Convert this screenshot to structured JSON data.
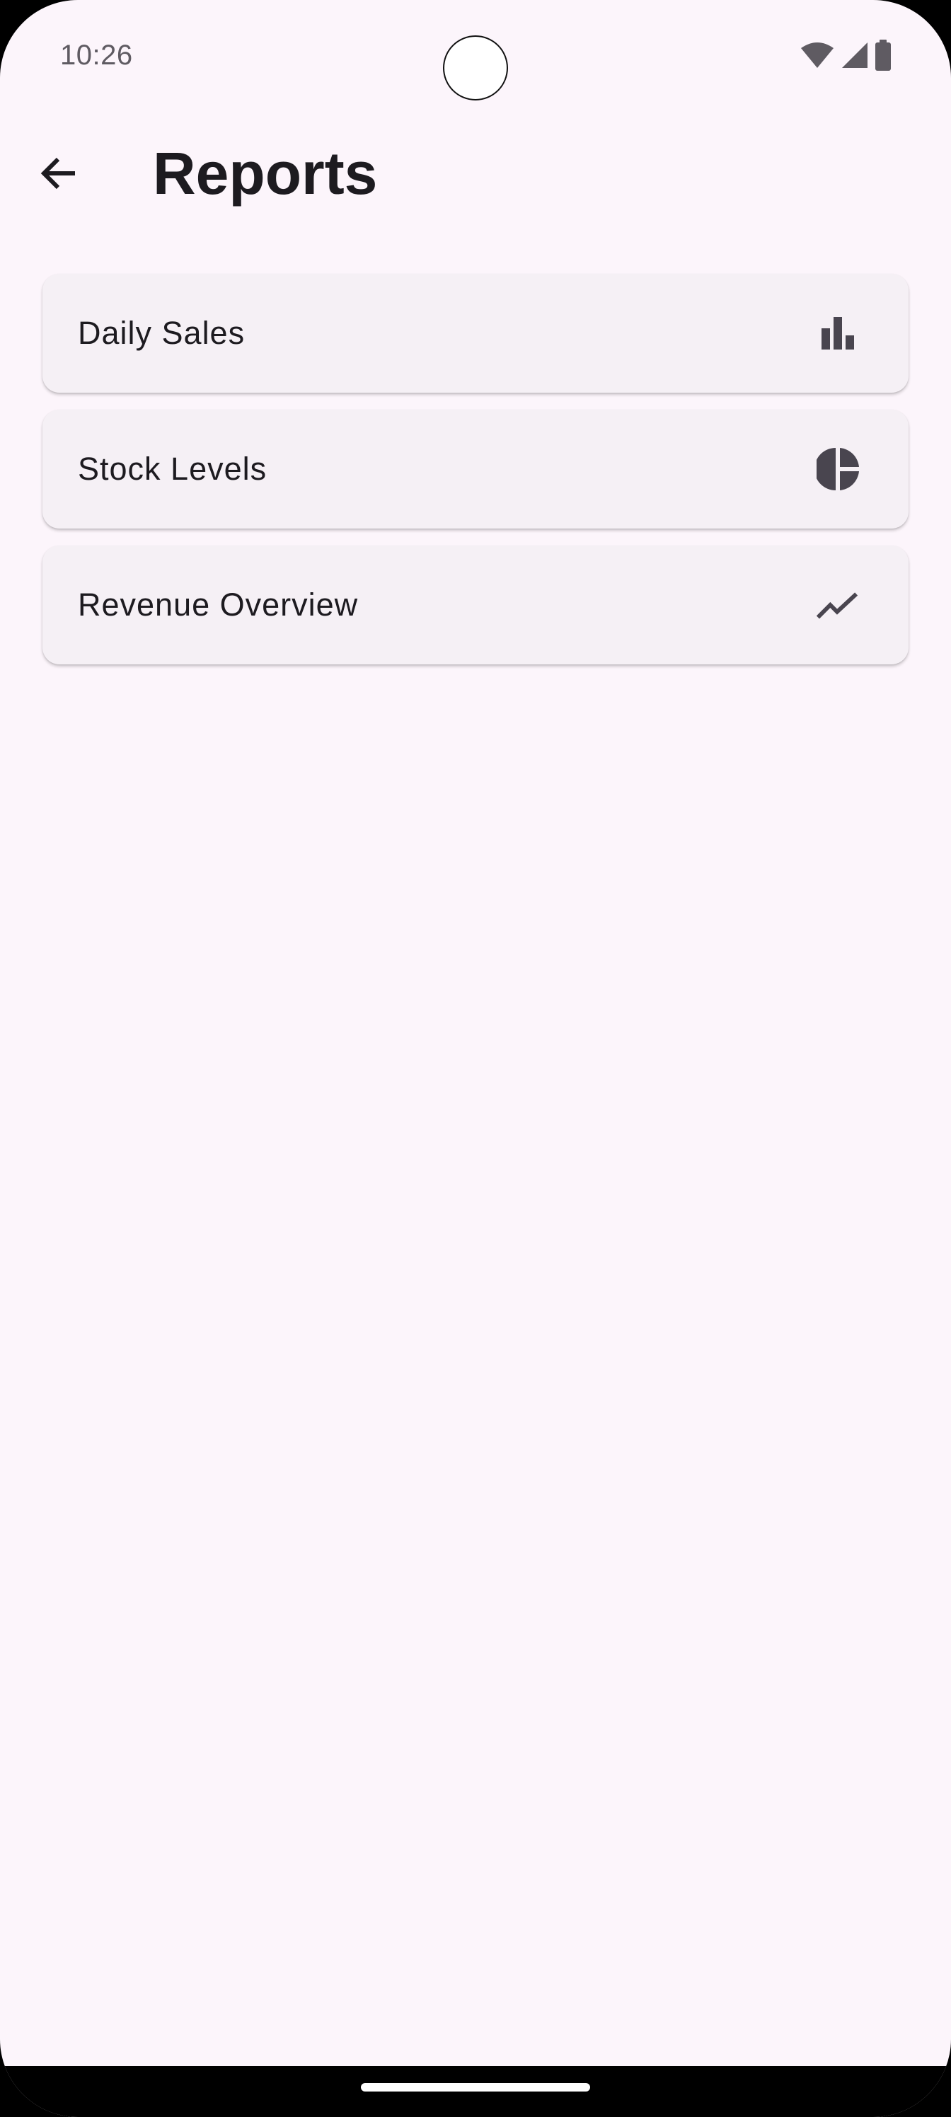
{
  "status_bar": {
    "time": "10:26",
    "icons": [
      "wifi-icon",
      "cellular-signal-icon",
      "battery-icon"
    ]
  },
  "app_bar": {
    "back_icon": "arrow-back-icon",
    "title": "Reports"
  },
  "reports": [
    {
      "label": "Daily Sales",
      "icon": "bar-chart-icon"
    },
    {
      "label": "Stock Levels",
      "icon": "pie-chart-icon"
    },
    {
      "label": "Revenue Overview",
      "icon": "trending-up-icon"
    }
  ],
  "colors": {
    "background": "#FCF5FB",
    "card": "#F5F0F5",
    "text": "#1D1B20",
    "icon": "#49454F"
  }
}
